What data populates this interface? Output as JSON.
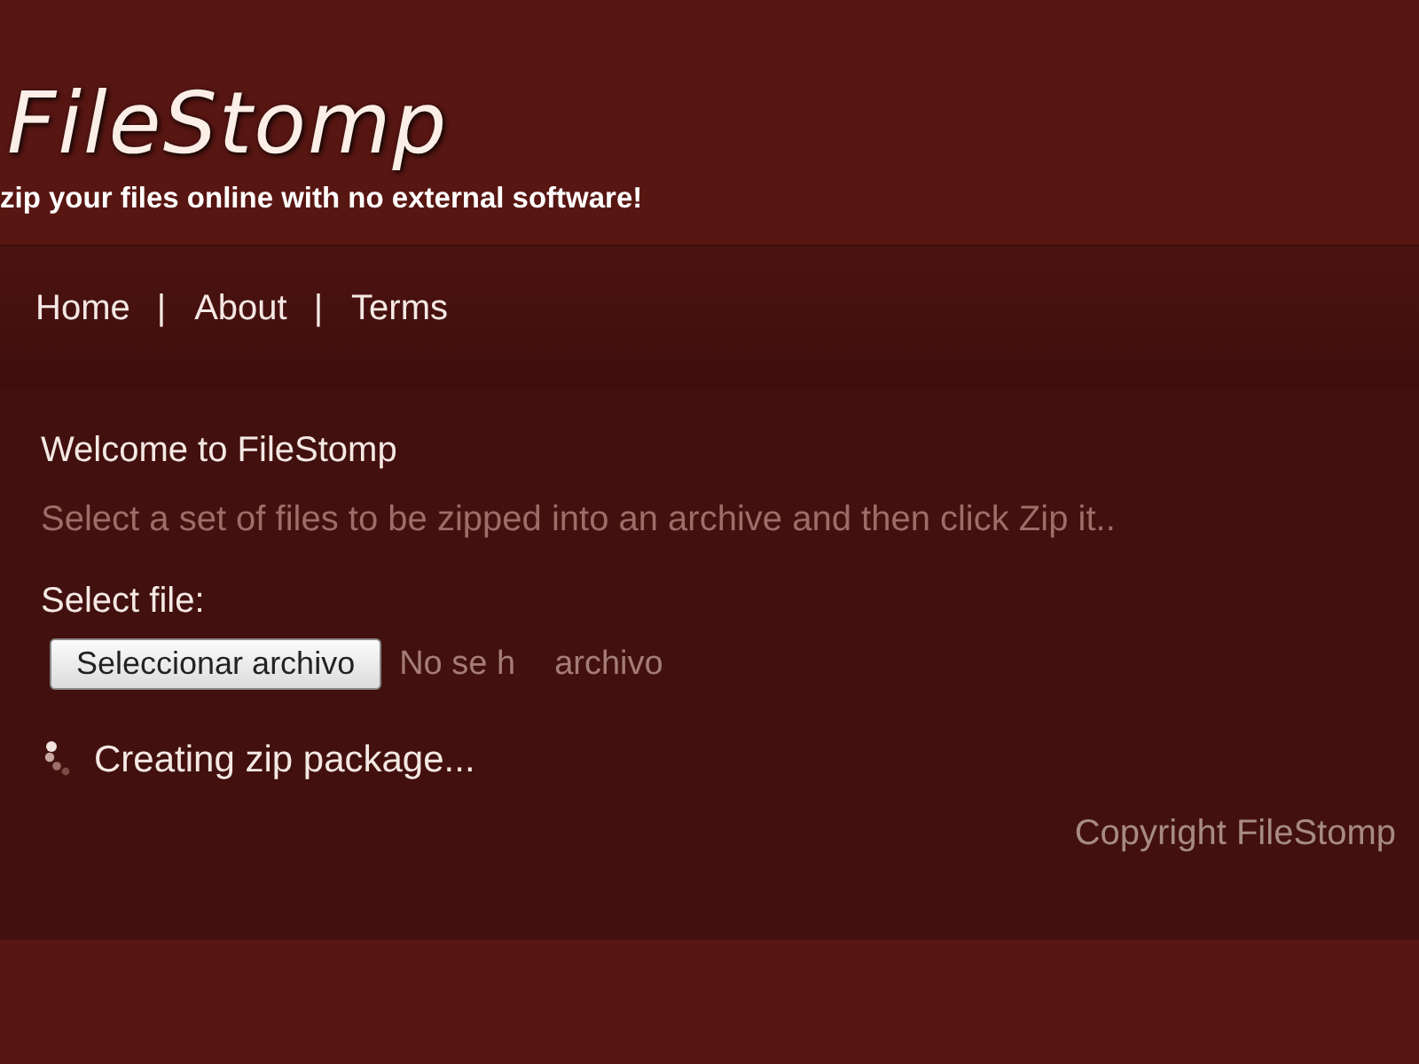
{
  "site": {
    "logo": "FileStomp",
    "tagline": "zip your files online with no external software!"
  },
  "nav": {
    "items": [
      {
        "label": "Home"
      },
      {
        "label": "About"
      },
      {
        "label": "Terms"
      }
    ],
    "separator": "|"
  },
  "content": {
    "heading": "Welcome to FileStomp",
    "intro": "Select a set of files to be zipped into an archive and then click Zip it..",
    "file_label": "Select file:",
    "file_button": "Seleccionar archivo",
    "file_status": [
      "No se h",
      "archivo"
    ],
    "progress_text": "Creating zip package...",
    "copyright": "Copyright FileStomp"
  }
}
